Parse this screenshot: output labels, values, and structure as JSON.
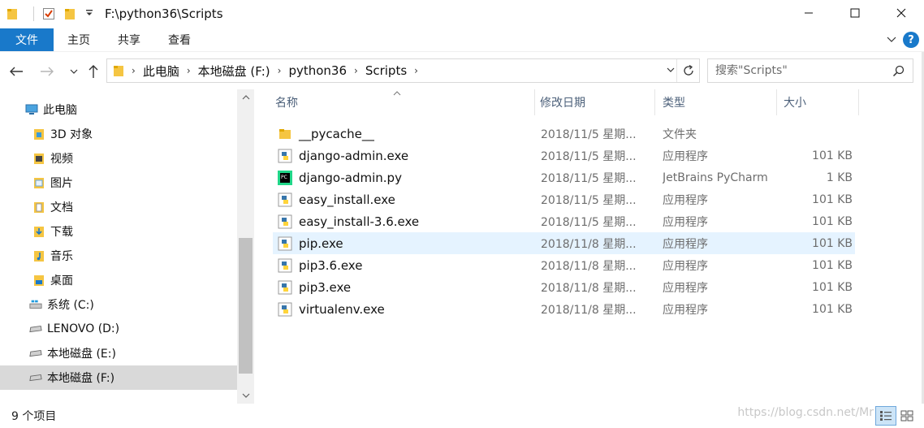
{
  "window": {
    "title": "F:\\python36\\Scripts"
  },
  "ribbon": {
    "tabs": [
      "文件",
      "主页",
      "共享",
      "查看"
    ]
  },
  "address": {
    "crumbs": [
      "此电脑",
      "本地磁盘 (F:)",
      "python36",
      "Scripts"
    ]
  },
  "search": {
    "placeholder": "搜索\"Scripts\""
  },
  "nav": {
    "items": [
      {
        "label": "此电脑",
        "icon": "computer-icon"
      },
      {
        "label": "3D 对象",
        "icon": "3d-objects-icon"
      },
      {
        "label": "视频",
        "icon": "video-icon"
      },
      {
        "label": "图片",
        "icon": "pictures-icon"
      },
      {
        "label": "文档",
        "icon": "documents-icon"
      },
      {
        "label": "下载",
        "icon": "downloads-icon"
      },
      {
        "label": "音乐",
        "icon": "music-icon"
      },
      {
        "label": "桌面",
        "icon": "desktop-icon"
      },
      {
        "label": "系统 (C:)",
        "icon": "windows-drive-icon"
      },
      {
        "label": "LENOVO (D:)",
        "icon": "drive-icon"
      },
      {
        "label": "本地磁盘 (E:)",
        "icon": "drive-icon"
      },
      {
        "label": "本地磁盘 (F:)",
        "icon": "drive-icon"
      }
    ],
    "selected_index": 11
  },
  "columns": {
    "name": "名称",
    "date": "修改日期",
    "type": "类型",
    "size": "大小"
  },
  "files": [
    {
      "name": "__pycache__",
      "date": "2018/11/5 星期...",
      "type": "文件夹",
      "size": "",
      "icon": "folder-icon"
    },
    {
      "name": "django-admin.exe",
      "date": "2018/11/5 星期...",
      "type": "应用程序",
      "size": "101 KB",
      "icon": "python-exe-icon"
    },
    {
      "name": "django-admin.py",
      "date": "2018/11/5 星期...",
      "type": "JetBrains PyCharm",
      "size": "1 KB",
      "icon": "pycharm-icon"
    },
    {
      "name": "easy_install.exe",
      "date": "2018/11/5 星期...",
      "type": "应用程序",
      "size": "101 KB",
      "icon": "python-exe-icon"
    },
    {
      "name": "easy_install-3.6.exe",
      "date": "2018/11/5 星期...",
      "type": "应用程序",
      "size": "101 KB",
      "icon": "python-exe-icon"
    },
    {
      "name": "pip.exe",
      "date": "2018/11/8 星期...",
      "type": "应用程序",
      "size": "101 KB",
      "icon": "python-exe-icon"
    },
    {
      "name": "pip3.6.exe",
      "date": "2018/11/8 星期...",
      "type": "应用程序",
      "size": "101 KB",
      "icon": "python-exe-icon"
    },
    {
      "name": "pip3.exe",
      "date": "2018/11/8 星期...",
      "type": "应用程序",
      "size": "101 KB",
      "icon": "python-exe-icon"
    },
    {
      "name": "virtualenv.exe",
      "date": "2018/11/8 星期...",
      "type": "应用程序",
      "size": "101 KB",
      "icon": "python-exe-icon"
    }
  ],
  "highlighted_row": 5,
  "status": {
    "count": "9 个项目"
  },
  "watermark": "https://blog.csdn.net/Mr",
  "colors": {
    "accent": "#1979ca",
    "selected_nav": "#d9d9d9",
    "hover_row": "#e5f3ff",
    "header_text": "#4c607a"
  }
}
